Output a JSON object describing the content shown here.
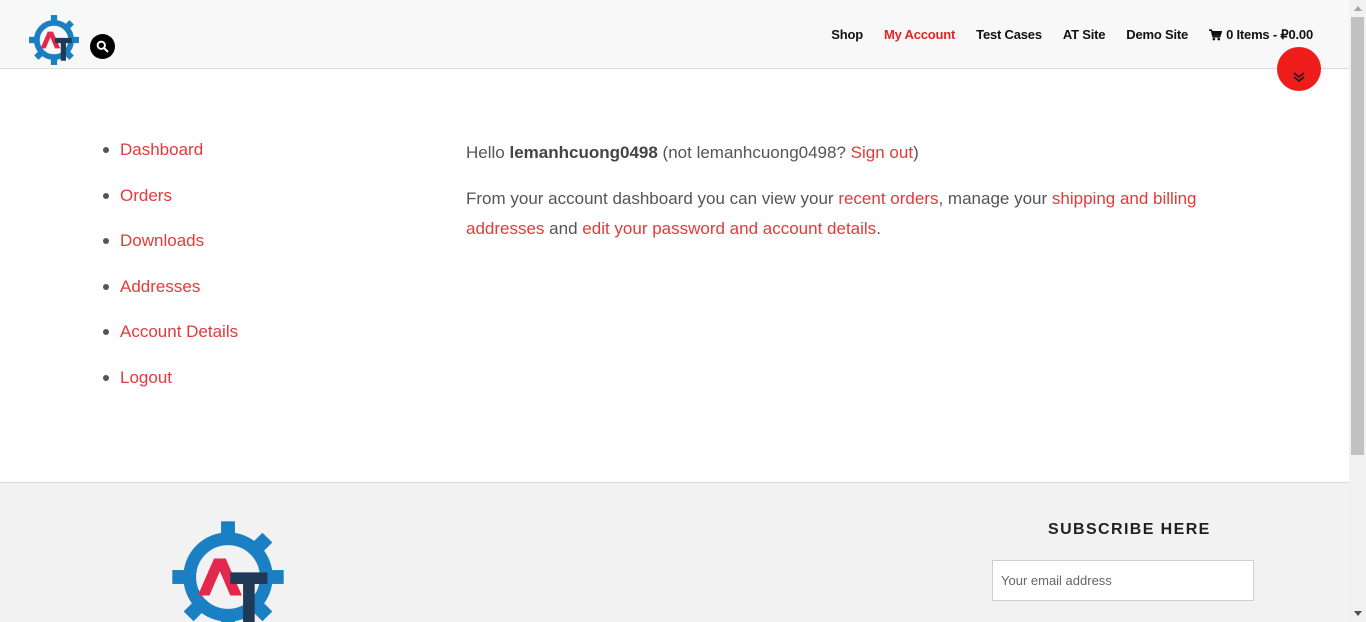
{
  "header": {
    "nav": [
      {
        "label": "Shop",
        "active": false
      },
      {
        "label": "My Account",
        "active": true
      },
      {
        "label": "Test Cases",
        "active": false
      },
      {
        "label": "AT Site",
        "active": false
      },
      {
        "label": "Demo Site",
        "active": false
      }
    ],
    "cart_label": "0 Items - ₽0.00",
    "search_icon": "search-icon",
    "cart_icon": "cart-icon"
  },
  "account_nav": {
    "items": [
      "Dashboard",
      "Orders",
      "Downloads",
      "Addresses",
      "Account Details",
      "Logout"
    ]
  },
  "content": {
    "hello": "Hello",
    "username": "lemanhcuong0498",
    "not_prefix": "(not",
    "not_username": "lemanhcuong0498?",
    "sign_out": "Sign out",
    "close_paren": ")",
    "intro": "From your account dashboard you can view your",
    "recent_orders": "recent orders",
    "manage": ", manage your",
    "addresses_link": "shipping and billing addresses",
    "and": "and",
    "account_link": "edit your password and account details",
    "period": "."
  },
  "footer": {
    "subscribe_title": "SUBSCRIBE HERE",
    "email_placeholder": "Your email address"
  },
  "colors": {
    "accent": "#e33a3a",
    "logo_blue": "#1b7fc4",
    "logo_red": "#e3274d",
    "logo_navy": "#1f3a57"
  }
}
